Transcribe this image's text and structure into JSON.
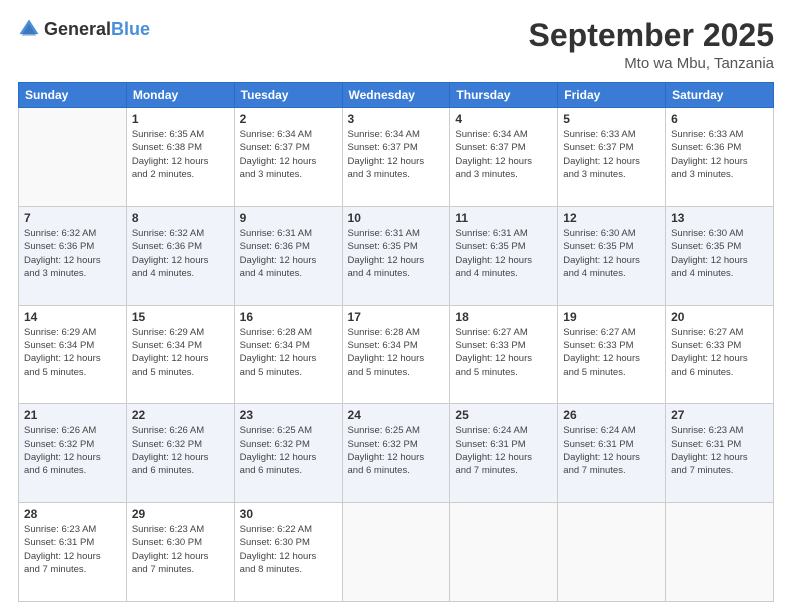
{
  "logo": {
    "general": "General",
    "blue": "Blue"
  },
  "header": {
    "month": "September 2025",
    "location": "Mto wa Mbu, Tanzania"
  },
  "days_of_week": [
    "Sunday",
    "Monday",
    "Tuesday",
    "Wednesday",
    "Thursday",
    "Friday",
    "Saturday"
  ],
  "weeks": [
    [
      {
        "day": "",
        "info": ""
      },
      {
        "day": "1",
        "info": "Sunrise: 6:35 AM\nSunset: 6:38 PM\nDaylight: 12 hours\nand 2 minutes."
      },
      {
        "day": "2",
        "info": "Sunrise: 6:34 AM\nSunset: 6:37 PM\nDaylight: 12 hours\nand 3 minutes."
      },
      {
        "day": "3",
        "info": "Sunrise: 6:34 AM\nSunset: 6:37 PM\nDaylight: 12 hours\nand 3 minutes."
      },
      {
        "day": "4",
        "info": "Sunrise: 6:34 AM\nSunset: 6:37 PM\nDaylight: 12 hours\nand 3 minutes."
      },
      {
        "day": "5",
        "info": "Sunrise: 6:33 AM\nSunset: 6:37 PM\nDaylight: 12 hours\nand 3 minutes."
      },
      {
        "day": "6",
        "info": "Sunrise: 6:33 AM\nSunset: 6:36 PM\nDaylight: 12 hours\nand 3 minutes."
      }
    ],
    [
      {
        "day": "7",
        "info": "Sunrise: 6:32 AM\nSunset: 6:36 PM\nDaylight: 12 hours\nand 3 minutes."
      },
      {
        "day": "8",
        "info": "Sunrise: 6:32 AM\nSunset: 6:36 PM\nDaylight: 12 hours\nand 4 minutes."
      },
      {
        "day": "9",
        "info": "Sunrise: 6:31 AM\nSunset: 6:36 PM\nDaylight: 12 hours\nand 4 minutes."
      },
      {
        "day": "10",
        "info": "Sunrise: 6:31 AM\nSunset: 6:35 PM\nDaylight: 12 hours\nand 4 minutes."
      },
      {
        "day": "11",
        "info": "Sunrise: 6:31 AM\nSunset: 6:35 PM\nDaylight: 12 hours\nand 4 minutes."
      },
      {
        "day": "12",
        "info": "Sunrise: 6:30 AM\nSunset: 6:35 PM\nDaylight: 12 hours\nand 4 minutes."
      },
      {
        "day": "13",
        "info": "Sunrise: 6:30 AM\nSunset: 6:35 PM\nDaylight: 12 hours\nand 4 minutes."
      }
    ],
    [
      {
        "day": "14",
        "info": "Sunrise: 6:29 AM\nSunset: 6:34 PM\nDaylight: 12 hours\nand 5 minutes."
      },
      {
        "day": "15",
        "info": "Sunrise: 6:29 AM\nSunset: 6:34 PM\nDaylight: 12 hours\nand 5 minutes."
      },
      {
        "day": "16",
        "info": "Sunrise: 6:28 AM\nSunset: 6:34 PM\nDaylight: 12 hours\nand 5 minutes."
      },
      {
        "day": "17",
        "info": "Sunrise: 6:28 AM\nSunset: 6:34 PM\nDaylight: 12 hours\nand 5 minutes."
      },
      {
        "day": "18",
        "info": "Sunrise: 6:27 AM\nSunset: 6:33 PM\nDaylight: 12 hours\nand 5 minutes."
      },
      {
        "day": "19",
        "info": "Sunrise: 6:27 AM\nSunset: 6:33 PM\nDaylight: 12 hours\nand 5 minutes."
      },
      {
        "day": "20",
        "info": "Sunrise: 6:27 AM\nSunset: 6:33 PM\nDaylight: 12 hours\nand 6 minutes."
      }
    ],
    [
      {
        "day": "21",
        "info": "Sunrise: 6:26 AM\nSunset: 6:32 PM\nDaylight: 12 hours\nand 6 minutes."
      },
      {
        "day": "22",
        "info": "Sunrise: 6:26 AM\nSunset: 6:32 PM\nDaylight: 12 hours\nand 6 minutes."
      },
      {
        "day": "23",
        "info": "Sunrise: 6:25 AM\nSunset: 6:32 PM\nDaylight: 12 hours\nand 6 minutes."
      },
      {
        "day": "24",
        "info": "Sunrise: 6:25 AM\nSunset: 6:32 PM\nDaylight: 12 hours\nand 6 minutes."
      },
      {
        "day": "25",
        "info": "Sunrise: 6:24 AM\nSunset: 6:31 PM\nDaylight: 12 hours\nand 7 minutes."
      },
      {
        "day": "26",
        "info": "Sunrise: 6:24 AM\nSunset: 6:31 PM\nDaylight: 12 hours\nand 7 minutes."
      },
      {
        "day": "27",
        "info": "Sunrise: 6:23 AM\nSunset: 6:31 PM\nDaylight: 12 hours\nand 7 minutes."
      }
    ],
    [
      {
        "day": "28",
        "info": "Sunrise: 6:23 AM\nSunset: 6:31 PM\nDaylight: 12 hours\nand 7 minutes."
      },
      {
        "day": "29",
        "info": "Sunrise: 6:23 AM\nSunset: 6:30 PM\nDaylight: 12 hours\nand 7 minutes."
      },
      {
        "day": "30",
        "info": "Sunrise: 6:22 AM\nSunset: 6:30 PM\nDaylight: 12 hours\nand 8 minutes."
      },
      {
        "day": "",
        "info": ""
      },
      {
        "day": "",
        "info": ""
      },
      {
        "day": "",
        "info": ""
      },
      {
        "day": "",
        "info": ""
      }
    ]
  ]
}
